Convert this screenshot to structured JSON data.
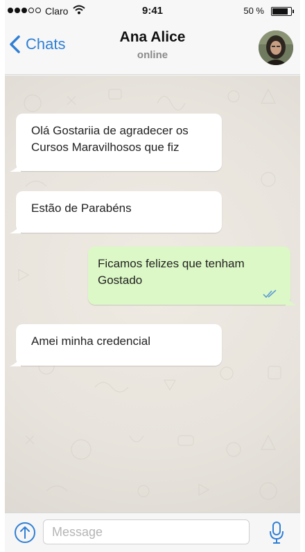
{
  "status_bar": {
    "carrier": "Claro",
    "time": "9:41",
    "battery_percent": "50 %",
    "battery_level": 0.8,
    "signal_dots_filled": 3,
    "signal_dots_total": 5
  },
  "nav": {
    "back_label": "Chats",
    "contact_name": "Ana Alice",
    "contact_status": "online"
  },
  "messages": [
    {
      "direction": "in",
      "lines": [
        "Olá Gostariia de agradecer os",
        "Cursos Maravilhosos que fiz"
      ]
    },
    {
      "direction": "in",
      "lines": [
        "Estão de Parabéns"
      ]
    },
    {
      "direction": "out",
      "lines": [
        "Ficamos felizes que tenham",
        "Gostado"
      ],
      "status": "read"
    },
    {
      "direction": "in",
      "lines": [
        "Amei minha credencial"
      ]
    }
  ],
  "composer": {
    "placeholder": "Message"
  },
  "colors": {
    "accent": "#2f7fd6",
    "outgoing_bubble": "#dcf8c6",
    "incoming_bubble": "#ffffff",
    "read_ticks": "#5b9bd5"
  },
  "icons": {
    "back": "chevron-left-icon",
    "attach": "arrow-up-circle-icon",
    "mic": "microphone-icon",
    "wifi": "wifi-icon",
    "read": "double-check-icon"
  }
}
